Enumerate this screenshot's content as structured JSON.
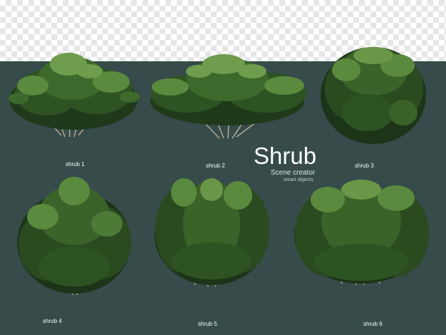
{
  "title": "Shrub",
  "subtitle": "Scene creator",
  "tagline": "smart objects",
  "labels": [
    "shrub 1",
    "shrub 2",
    "shrub 3",
    "shrub 4",
    "shrub 5",
    "shrub 6"
  ],
  "colors": {
    "background": "#364b4a",
    "foliage_dark": "#1f3a1a",
    "foliage_mid": "#3d6a2c",
    "foliage_light": "#6f9c4d",
    "stem": "#b4a58a"
  }
}
